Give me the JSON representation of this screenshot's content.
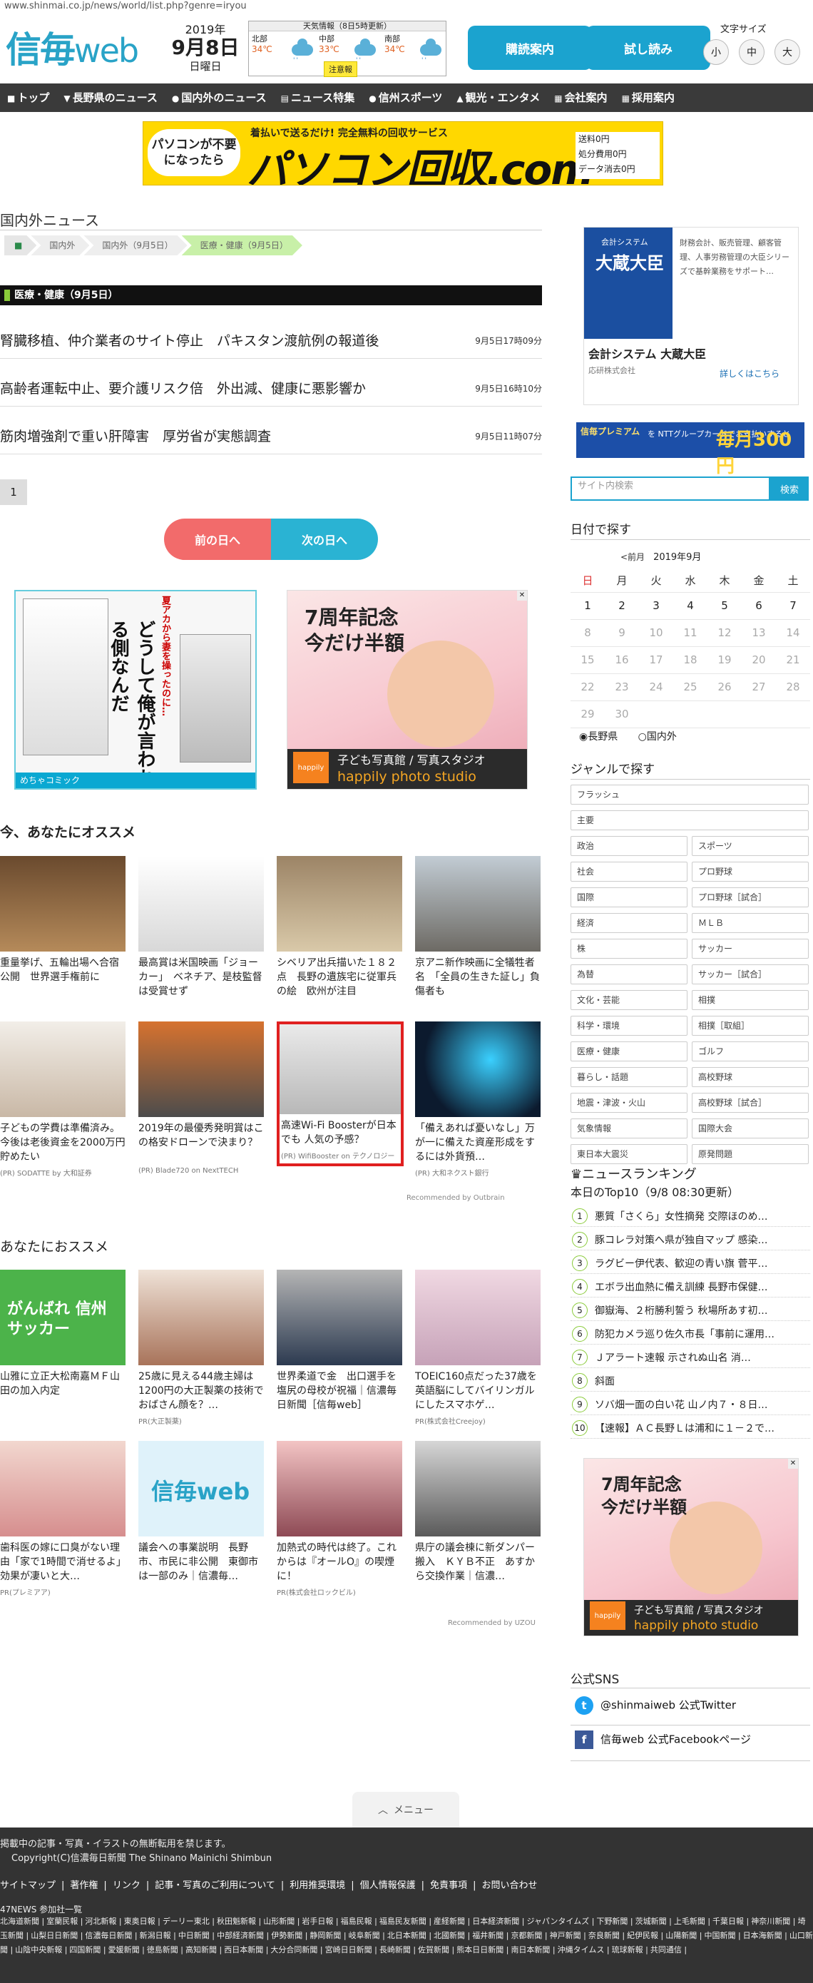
{
  "browser": {
    "url": "www.shinmai.co.jp/news/world/list.php?genre=iryou"
  },
  "header": {
    "logo_main": "信毎",
    "logo_sub": "web",
    "year": "2019年",
    "date": "9月8日",
    "weekday": "日曜日",
    "weather": {
      "title": "天気情報（8日5時更新）",
      "regions": [
        {
          "name": "北部",
          "temp": "34℃"
        },
        {
          "name": "中部",
          "temp": "33℃"
        },
        {
          "name": "南部",
          "temp": "34℃"
        }
      ],
      "alert": "注意報"
    },
    "subscribe_button": "購読案内",
    "trial_button": "試し読み",
    "font_size_label": "文字サイズ",
    "font_sizes": [
      "小",
      "中",
      "大"
    ]
  },
  "nav": [
    "トップ",
    "長野県のニュース",
    "国内外のニュース",
    "ニュース特集",
    "信州スポーツ",
    "観光・エンタメ",
    "会社案内",
    "採用案内"
  ],
  "top_ad": {
    "left": "パソコンが不要になったら",
    "tagline": "着払いで送るだけ! 完全無料の回収サービス",
    "brand": "パソコン回収.com",
    "right": [
      "送料0円",
      "処分費用0円",
      "データ消去0円"
    ]
  },
  "main": {
    "section_title": "国内外ニュース",
    "breadcrumbs": [
      "国内外",
      "国内外（9月5日）",
      "医療・健康（9月5日）"
    ],
    "category_bar": "医療・健康（9月5日）",
    "articles": [
      {
        "title": "腎臓移植、仲介業者のサイト停止　パキスタン渡航例の報道後",
        "time": "9月5日17時09分"
      },
      {
        "title": "高齢者運転中止、要介護リスク倍　外出減、健康に悪影響か",
        "time": "9月5日16時10分"
      },
      {
        "title": "筋肉増強剤で重い肝障害　厚労省が実態調査",
        "time": "9月5日11時07分"
      }
    ],
    "page_number": "1",
    "prev_day": "前の日へ",
    "next_day": "次の日へ",
    "ad_manga": {
      "title": "どうして俺が言われる側なんだ",
      "tag": "夏アカから妻を操ったのに…",
      "footer": "めちゃコミック"
    },
    "ad_photo": {
      "headline_1": "7周年記念",
      "headline_2": "今だけ半額",
      "brand": "happily",
      "line_1": "子ども写真館 / 写真スタジオ",
      "line_2": "happily photo studio"
    },
    "recommend_title": "今、あなたにオススメ",
    "recommend": [
      {
        "text": "重量挙げ、五輪出場へ合宿公開　世界選手権前に",
        "source": ""
      },
      {
        "text": "最高賞は米国映画「ジョーカー」　ベネチア、是枝監督は受賞せず",
        "source": ""
      },
      {
        "text": "シベリア出兵描いた１８２点　長野の遺族宅に従軍兵の絵　欧州が注目",
        "source": ""
      },
      {
        "text": "京アニ新作映画に全犠牲者名　「全員の生きた証し」負傷者も",
        "source": ""
      },
      {
        "text": "子どもの学費は準備済み。今後は老後資金を2000万円貯めたい",
        "source": "(PR) SODATTE by 大和証券"
      },
      {
        "text": "2019年の最優秀発明賞はこの格安ドローンで決まり？",
        "source": "(PR) Blade720 on NextTECH"
      },
      {
        "text": "高速Wi-Fi Boosterが日本でも 人気の予感？",
        "source": "(PR) WifiBooster on テクノロジー"
      },
      {
        "text": "「備えあれば憂いなし」万が一に備えた資産形成をするには外貨預…",
        "source": "(PR) 大和ネクスト銀行"
      }
    ],
    "recommended_by": "Recommended by Outbrain",
    "your_recommend_title": "あなたにおススメ",
    "your_recommend": [
      {
        "text": "山雅に立正大松南嘉ＭＦ山田の加入内定",
        "source": "",
        "img_label": "がんばれ 信州サッカー"
      },
      {
        "text": "25歳に見える44歳主婦は1200円の大正製薬の技術でおばさん顔を？…",
        "source": "PR(大正製薬)",
        "img_label": ""
      },
      {
        "text": "世界柔道で金　出口選手を塩尻の母校が祝福｜信濃毎日新聞［信毎web］",
        "source": "",
        "img_label": ""
      },
      {
        "text": "TOEIC160点だった37歳を英語脳にしてバイリンガルにしたスマホゲ…",
        "source": "PR(株式会社Creejoy)",
        "img_label": ""
      },
      {
        "text": "歯科医の嫁に口臭がない理由「家で1時間で消せるよ」効果が凄いと大…",
        "source": "PR(プレミアア)",
        "img_label": ""
      },
      {
        "text": "議会への事業説明　長野市、市民に非公開　東御市は一部のみ｜信濃毎…",
        "source": "",
        "img_label": "信毎web"
      },
      {
        "text": "加熱式の時代は終了。これからは『オールО』の喫煙に！",
        "source": "PR(株式会社ロックビル)",
        "img_label": ""
      },
      {
        "text": "県庁の議会棟に新ダンパー搬入　ＫＹＢ不正　あすから交換作業｜信濃…",
        "source": "",
        "img_label": ""
      }
    ],
    "recommended_by_2": "Recommended by UZOU"
  },
  "sidebar": {
    "ad": {
      "small": "会計システム",
      "big": "大蔵大臣",
      "desc": "財務会計、販売管理、顧客管理、人事労務管理の大臣シリーズで基幹業務をサポート…",
      "name": "会計システム 大蔵大臣",
      "company": "応研株式会社",
      "more": "詳しくはこちら"
    },
    "ad2": {
      "a": "信毎プレミアム",
      "b": "を NTTグループカードでお支払いすると",
      "c": "毎月300円"
    },
    "search_placeholder": "サイト内検索",
    "search_button": "検索",
    "date_title": "日付で探す",
    "calendar": {
      "prev": "<前月",
      "month": "2019年9月",
      "weekdays": [
        "日",
        "月",
        "火",
        "水",
        "木",
        "金",
        "土"
      ],
      "weeks": [
        [
          "1",
          "2",
          "3",
          "4",
          "5",
          "6",
          "7"
        ],
        [
          "8",
          "9",
          "10",
          "11",
          "12",
          "13",
          "14"
        ],
        [
          "15",
          "16",
          "17",
          "18",
          "19",
          "20",
          "21"
        ],
        [
          "22",
          "23",
          "24",
          "25",
          "26",
          "27",
          "28"
        ],
        [
          "29",
          "30",
          "",
          "",
          "",
          "",
          ""
        ]
      ],
      "active_through": 7
    },
    "radios": [
      "長野県",
      "国内外"
    ],
    "genre_title": "ジャンルで探す",
    "genre_wide": [
      "フラッシュ",
      "主要"
    ],
    "genres": [
      [
        "政治",
        "スポーツ"
      ],
      [
        "社会",
        "プロ野球"
      ],
      [
        "国際",
        "プロ野球［試合］"
      ],
      [
        "経済",
        "ＭＬＢ"
      ],
      [
        "株",
        "サッカー"
      ],
      [
        "為替",
        "サッカー［試合］"
      ],
      [
        "文化・芸能",
        "相撲"
      ],
      [
        "科学・環境",
        "相撲［取組］"
      ],
      [
        "医療・健康",
        "ゴルフ"
      ],
      [
        "暮らし・話題",
        "高校野球"
      ],
      [
        "地震・津波・火山",
        "高校野球［試合］"
      ],
      [
        "気象情報",
        "国際大会"
      ],
      [
        "東日本大震災",
        "原発問題"
      ]
    ],
    "ranking_title": "ニュースランキング",
    "ranking_sub": "本日のTop10（9/8 08:30更新）",
    "ranking": [
      "悪質「さくら」女性摘発 交際ほのめ…",
      "豚コレラ対策へ県が独自マップ 感染…",
      "ラグビー伊代表、歓迎の青い旗 菅平…",
      "エボラ出血熱に備え訓練 長野市保健…",
      "御嶽海、２桁勝利誓う 秋場所あす初…",
      "防犯カメラ巡り佐久市長「事前に運用…",
      "Ｊアラート速報 示されぬ山名 消…",
      "斜面",
      "ソバ畑一面の白い花 山ノ内７・８日…",
      "【速報】ＡＣ長野Ｌは浦和に１－２で…"
    ],
    "sns_title": "公式SNS",
    "twitter": "@shinmaiweb 公式Twitter",
    "facebook": "信毎web 公式Facebookページ"
  },
  "menu_label": "メニュー",
  "footer": {
    "notice": "掲載中の記事・写真・イラストの無断転用を禁じます。",
    "copyright": "Copyright(C)信濃毎日新聞 The Shinano Mainichi Shimbun",
    "links": [
      "サイトマップ",
      "著作権",
      "リンク",
      "記事・写真のご利用について",
      "利用推奨環境",
      "個人情報保護",
      "免責事項",
      "お問い合わせ"
    ],
    "partner_title": "47NEWS 参加社一覧",
    "papers": [
      "北海道新聞",
      "室蘭民報",
      "河北新報",
      "東奥日報",
      "デーリー東北",
      "秋田魁新報",
      "山形新聞",
      "岩手日報",
      "福島民報",
      "福島民友新聞",
      "産経新聞",
      "日本経済新聞",
      "ジャパンタイムズ",
      "下野新聞",
      "茨城新聞",
      "上毛新聞",
      "千葉日報",
      "神奈川新聞",
      "埼玉新聞",
      "山梨日日新聞",
      "信濃毎日新聞",
      "新潟日報",
      "中日新聞",
      "中部経済新聞",
      "伊勢新聞",
      "静岡新聞",
      "岐阜新聞",
      "北日本新聞",
      "北國新聞",
      "福井新聞",
      "京都新聞",
      "神戸新聞",
      "奈良新聞",
      "紀伊民報",
      "山陽新聞",
      "中国新聞",
      "日本海新聞",
      "山口新聞",
      "山陰中央新報",
      "四国新聞",
      "愛媛新聞",
      "徳島新聞",
      "高知新聞",
      "西日本新聞",
      "大分合同新聞",
      "宮崎日日新聞",
      "長崎新聞",
      "佐賀新聞",
      "熊本日日新聞",
      "南日本新聞",
      "沖縄タイムス",
      "琉球新報",
      "共同通信"
    ]
  }
}
